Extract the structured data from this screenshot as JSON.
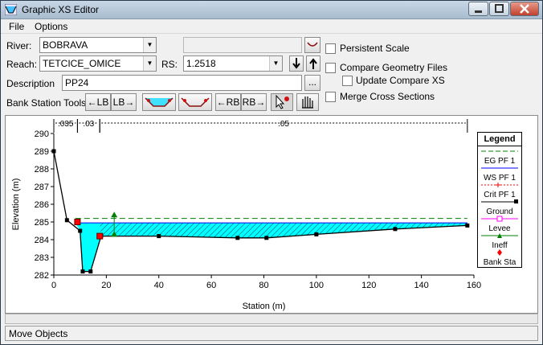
{
  "window": {
    "title": "Graphic XS Editor"
  },
  "menu": {
    "file": "File",
    "options": "Options"
  },
  "form": {
    "river_label": "River:",
    "river_value": "BOBRAVA",
    "reach_label": "Reach:",
    "reach_value": "TETCICE_OMICE",
    "rs_label": "RS:",
    "rs_value": "1.2518",
    "description_label": "Description",
    "description_value": "PP24",
    "browse_label": "...",
    "bank_tools_label": "Bank Station Tools:",
    "lb_left": "←LB",
    "lb_right": "LB→",
    "rb_left": "←RB",
    "rb_right": "RB→"
  },
  "options": {
    "persistent_scale": "Persistent Scale",
    "compare_geometry": "Compare Geometry Files",
    "update_compare": "Update Compare XS",
    "merge_sections": "Merge Cross Sections"
  },
  "status": {
    "text": "Move Objects"
  },
  "colors": {
    "water": "#00ffff",
    "eg": "#008000",
    "ws": "#0000ff",
    "crit": "#ff0000",
    "ground": "#000000",
    "levee": "#ff00ff",
    "ineff": "#008000",
    "bank": "#ff0000"
  },
  "chart_data": {
    "type": "line",
    "xlabel": "Station (m)",
    "ylabel": "Elevation (m)",
    "xlim": [
      0,
      160
    ],
    "ylim": [
      282,
      290
    ],
    "xticks": [
      0,
      20,
      40,
      60,
      80,
      100,
      120,
      140,
      160
    ],
    "yticks": [
      282,
      283,
      284,
      285,
      286,
      287,
      288,
      289,
      290
    ],
    "manning": [
      {
        "label": ".035",
        "from": 0,
        "to": 9
      },
      {
        "label": ".03",
        "from": 9,
        "to": 17.5
      },
      {
        "label": ".05",
        "from": 17.5,
        "to": 157.5
      }
    ],
    "ground": {
      "x": [
        0,
        5,
        10,
        11,
        14,
        18,
        40,
        70,
        81,
        100,
        130,
        157.5
      ],
      "y": [
        289.0,
        285.1,
        284.5,
        282.2,
        282.2,
        284.2,
        284.2,
        284.1,
        284.1,
        284.3,
        284.6,
        284.8
      ]
    },
    "ws_elevation": 284.95,
    "eg_elevation": 285.2,
    "water_extent": [
      8.2,
      157.5
    ],
    "bank_stations": [
      {
        "x": 9,
        "y": 285.0
      },
      {
        "x": 17.5,
        "y": 284.2
      }
    ],
    "ineffective": [
      {
        "x": 23,
        "y": 285.4
      },
      {
        "x": 23,
        "y": 284.3
      }
    ],
    "legend": {
      "title": "Legend",
      "items": [
        "EG PF 1",
        "WS PF 1",
        "Crit PF 1",
        "Ground",
        "Levee",
        "Ineff",
        "Bank Sta"
      ]
    }
  }
}
